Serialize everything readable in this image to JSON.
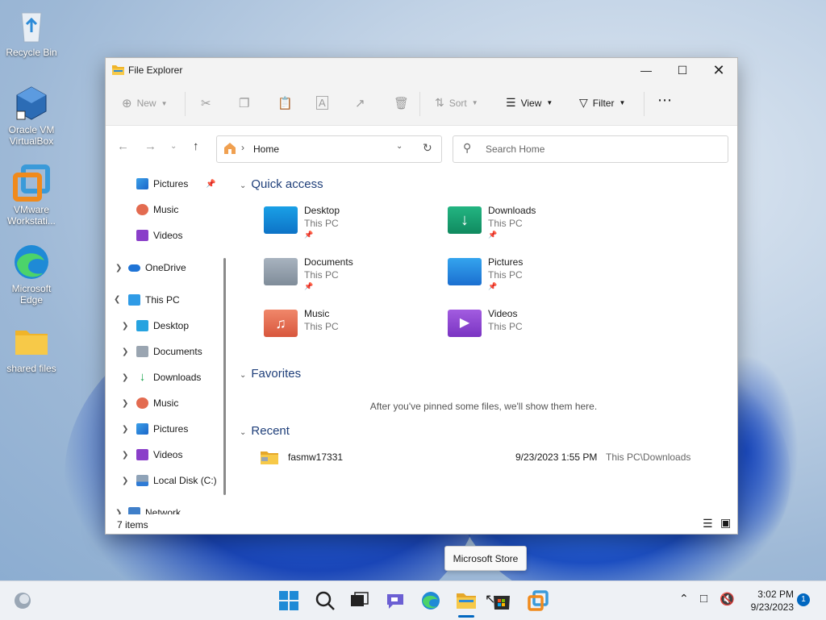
{
  "desktop": {
    "icons": [
      {
        "label": "Recycle Bin"
      },
      {
        "label1": "Oracle VM",
        "label2": "VirtualBox"
      },
      {
        "label1": "VMware",
        "label2": "Workstati..."
      },
      {
        "label1": "Microsoft",
        "label2": "Edge"
      },
      {
        "label": "shared files"
      }
    ]
  },
  "window": {
    "title": "File Explorer",
    "toolbar": {
      "new_label": "New",
      "sort_label": "Sort",
      "view_label": "View",
      "filter_label": "Filter"
    },
    "address": {
      "path": "Home"
    },
    "search": {
      "placeholder": "Search Home"
    },
    "sidebar": {
      "items": [
        {
          "label": "Pictures"
        },
        {
          "label": "Music"
        },
        {
          "label": "Videos"
        },
        {
          "label": "OneDrive"
        },
        {
          "label": "This PC"
        },
        {
          "label": "Desktop"
        },
        {
          "label": "Documents"
        },
        {
          "label": "Downloads"
        },
        {
          "label": "Music"
        },
        {
          "label": "Pictures"
        },
        {
          "label": "Videos"
        },
        {
          "label": "Local Disk (C:)"
        },
        {
          "label": "Network"
        }
      ]
    },
    "quick_access": {
      "title": "Quick access",
      "items": [
        {
          "name": "Desktop",
          "location": "This PC"
        },
        {
          "name": "Downloads",
          "location": "This PC"
        },
        {
          "name": "Documents",
          "location": "This PC"
        },
        {
          "name": "Pictures",
          "location": "This PC"
        },
        {
          "name": "Music",
          "location": "This PC"
        },
        {
          "name": "Videos",
          "location": "This PC"
        }
      ]
    },
    "favorites": {
      "title": "Favorites",
      "empty_text": "After you've pinned some files, we'll show them here."
    },
    "recent": {
      "title": "Recent",
      "items": [
        {
          "name": "fasmw17331",
          "date": "9/23/2023 1:55 PM",
          "location": "This PC\\Downloads"
        }
      ]
    },
    "status": {
      "count": "7 items"
    }
  },
  "tooltip": {
    "text": "Microsoft Store"
  },
  "taskbar": {
    "time": "3:02 PM",
    "date": "9/23/2023",
    "notification_count": "1"
  },
  "colors": {
    "accent": "#0067c0",
    "folder_yellow": "#f7c948"
  }
}
